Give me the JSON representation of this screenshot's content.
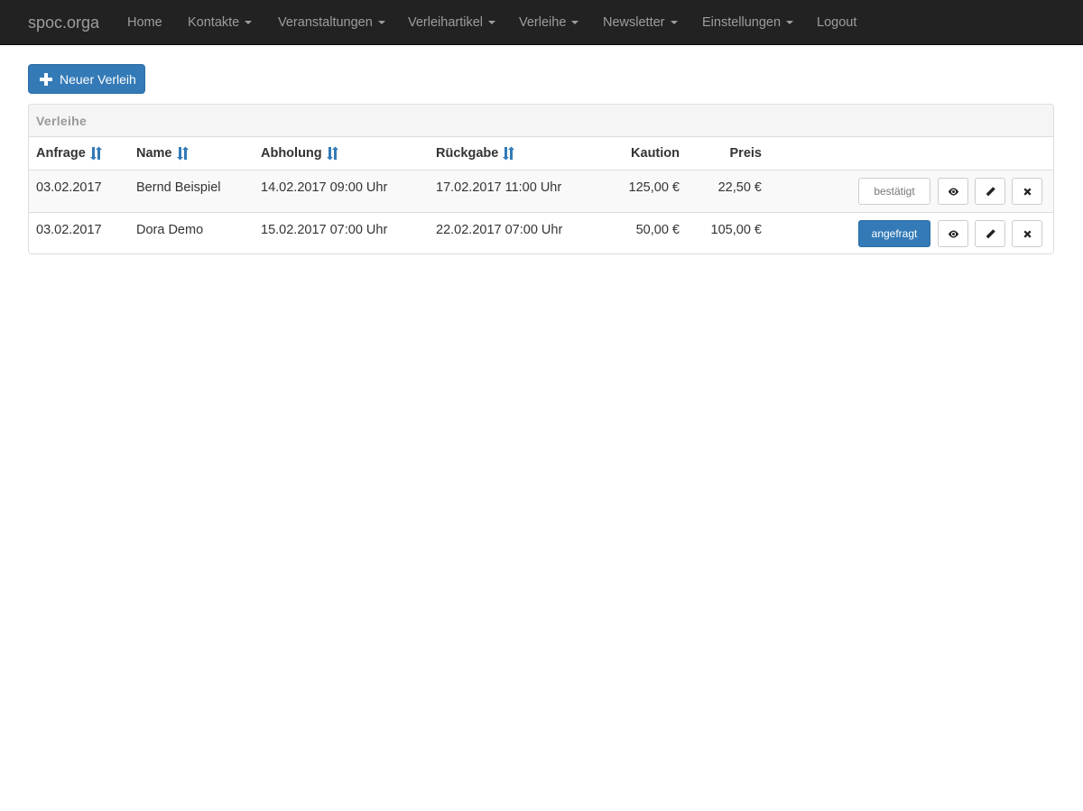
{
  "navbar": {
    "brand": "spoc.orga",
    "items": [
      {
        "label": "Home",
        "dropdown": false
      },
      {
        "label": "Kontakte",
        "dropdown": true
      },
      {
        "label": "Veranstaltungen",
        "dropdown": true
      },
      {
        "label": "Verleihartikel",
        "dropdown": true
      },
      {
        "label": "Verleihe",
        "dropdown": true
      },
      {
        "label": "Newsletter",
        "dropdown": true
      },
      {
        "label": "Einstellungen",
        "dropdown": true
      },
      {
        "label": "Logout",
        "dropdown": false
      }
    ]
  },
  "toolbar": {
    "new_button_label": "Neuer Verleih",
    "new_button_icon": "plus-icon"
  },
  "panel": {
    "title": "Verleihe"
  },
  "table": {
    "columns": [
      {
        "label": "Anfrage",
        "sortable": true
      },
      {
        "label": "Name",
        "sortable": true
      },
      {
        "label": "Abholung",
        "sortable": true
      },
      {
        "label": "Rückgabe",
        "sortable": true
      },
      {
        "label": "Kaution",
        "sortable": false
      },
      {
        "label": "Preis",
        "sortable": false
      }
    ],
    "rows": [
      {
        "anfrage": "03.02.2017",
        "name": "Bernd Beispiel",
        "abholung": "14.02.2017 09:00 Uhr",
        "rueckgabe": "17.02.2017 11:00 Uhr",
        "kaution": "125,00 €",
        "preis": "22,50 €",
        "status": "bestätigt",
        "status_style": "default"
      },
      {
        "anfrage": "03.02.2017",
        "name": "Dora Demo",
        "abholung": "15.02.2017 07:00 Uhr",
        "rueckgabe": "22.02.2017 07:00 Uhr",
        "kaution": "50,00 €",
        "preis": "105,00 €",
        "status": "angefragt",
        "status_style": "primary"
      }
    ],
    "row_actions": [
      "eye-icon",
      "pencil-icon",
      "close-icon"
    ]
  },
  "colors": {
    "navbar_bg": "#222222",
    "navbar_text": "#9d9d9d",
    "primary": "#337ab7",
    "sort_icon": "#337ab7"
  }
}
